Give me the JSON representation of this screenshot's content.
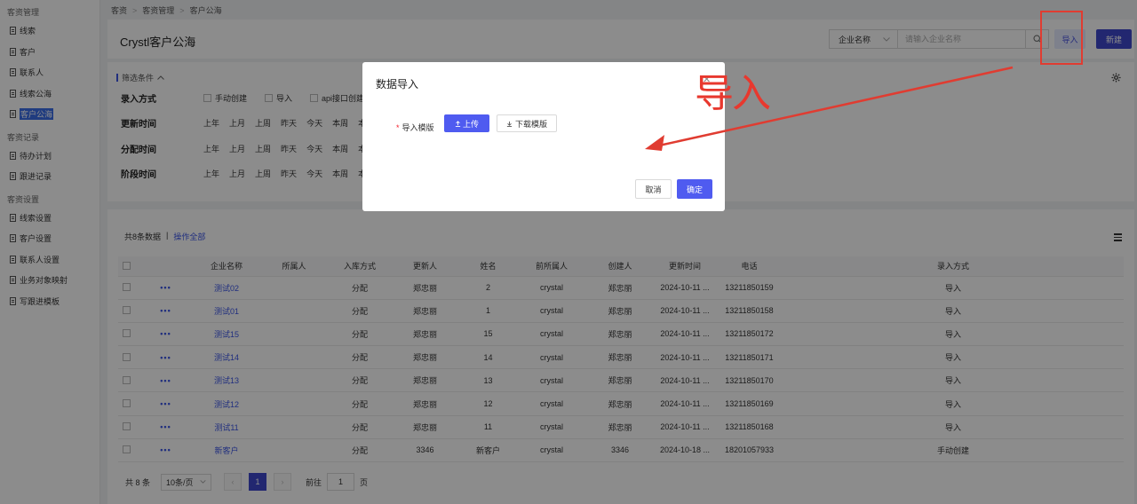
{
  "sidebar": {
    "groups": [
      {
        "title": "客资管理",
        "items": [
          {
            "label": "线索"
          },
          {
            "label": "客户"
          },
          {
            "label": "联系人"
          },
          {
            "label": "线索公海"
          },
          {
            "label": "客户公海",
            "active": true
          }
        ]
      },
      {
        "title": "客资记录",
        "items": [
          {
            "label": "待办计划"
          },
          {
            "label": "跟进记录"
          }
        ]
      },
      {
        "title": "客资设置",
        "items": [
          {
            "label": "线索设置"
          },
          {
            "label": "客户设置"
          },
          {
            "label": "联系人设置"
          },
          {
            "label": "业务对象映射"
          },
          {
            "label": "写跟进模板"
          }
        ]
      }
    ]
  },
  "breadcrumb": [
    "客资",
    "客资管理",
    "客户公海"
  ],
  "header": {
    "title": "Crystl客户公海",
    "search_select": "企业名称",
    "search_placeholder": "请输入企业名称",
    "import_label": "导入",
    "new_label": "新建"
  },
  "filter": {
    "title": "筛选条件",
    "rows": [
      {
        "label": "录入方式",
        "options": [
          "手动创建",
          "导入",
          "api接口创建"
        ],
        "checkbox": true
      },
      {
        "label": "更新时间",
        "options": [
          "上年",
          "上月",
          "上周",
          "昨天",
          "今天",
          "本周",
          "本"
        ]
      },
      {
        "label": "分配时间",
        "options": [
          "上年",
          "上月",
          "上周",
          "昨天",
          "今天",
          "本周",
          "本"
        ]
      },
      {
        "label": "阶段时间",
        "options": [
          "上年",
          "上月",
          "上周",
          "昨天",
          "今天",
          "本周",
          "本"
        ]
      }
    ]
  },
  "table": {
    "summary": "共8条数据",
    "divider": "|",
    "action_all": "操作全部",
    "more_label": "•••",
    "columns": [
      "企业名称",
      "所属人",
      "入库方式",
      "更新人",
      "姓名",
      "前所属人",
      "创建人",
      "更新时间",
      "电话",
      "录入方式"
    ],
    "rows": [
      {
        "name": "测试02",
        "owner": "",
        "method": "分配",
        "updater": "郑忠丽",
        "person": "2",
        "prev_owner": "crystal",
        "creator": "郑忠丽",
        "updated": "2024-10-11 ...",
        "phone": "13211850159",
        "source": "导入"
      },
      {
        "name": "测试01",
        "owner": "",
        "method": "分配",
        "updater": "郑忠丽",
        "person": "1",
        "prev_owner": "crystal",
        "creator": "郑忠丽",
        "updated": "2024-10-11 ...",
        "phone": "13211850158",
        "source": "导入"
      },
      {
        "name": "测试15",
        "owner": "",
        "method": "分配",
        "updater": "郑忠丽",
        "person": "15",
        "prev_owner": "crystal",
        "creator": "郑忠丽",
        "updated": "2024-10-11 ...",
        "phone": "13211850172",
        "source": "导入"
      },
      {
        "name": "测试14",
        "owner": "",
        "method": "分配",
        "updater": "郑忠丽",
        "person": "14",
        "prev_owner": "crystal",
        "creator": "郑忠丽",
        "updated": "2024-10-11 ...",
        "phone": "13211850171",
        "source": "导入"
      },
      {
        "name": "测试13",
        "owner": "",
        "method": "分配",
        "updater": "郑忠丽",
        "person": "13",
        "prev_owner": "crystal",
        "creator": "郑忠丽",
        "updated": "2024-10-11 ...",
        "phone": "13211850170",
        "source": "导入"
      },
      {
        "name": "测试12",
        "owner": "",
        "method": "分配",
        "updater": "郑忠丽",
        "person": "12",
        "prev_owner": "crystal",
        "creator": "郑忠丽",
        "updated": "2024-10-11 ...",
        "phone": "13211850169",
        "source": "导入"
      },
      {
        "name": "测试11",
        "owner": "",
        "method": "分配",
        "updater": "郑忠丽",
        "person": "11",
        "prev_owner": "crystal",
        "creator": "郑忠丽",
        "updated": "2024-10-11 ...",
        "phone": "13211850168",
        "source": "导入"
      },
      {
        "name": "新客户",
        "owner": "",
        "method": "分配",
        "updater": "3346",
        "person": "新客户",
        "prev_owner": "crystal",
        "creator": "3346",
        "updated": "2024-10-18 ...",
        "phone": "18201057933",
        "source": "手动创建"
      }
    ]
  },
  "pagination": {
    "total": "共 8 条",
    "page_size": "10条/页",
    "current": "1",
    "goto_label": "前往",
    "goto_value": "1",
    "page_suffix": "页"
  },
  "modal": {
    "title": "数据导入",
    "template_label": "导入模版",
    "upload_label": "上传",
    "download_label": "下载模版",
    "cancel_label": "取消",
    "ok_label": "确定"
  },
  "annotation": {
    "text": "导入",
    "color": "#e03c31"
  },
  "colors": {
    "primary": "#3f48cc",
    "link": "#3b55e6",
    "active_sidebar": "#3b6ee8"
  }
}
